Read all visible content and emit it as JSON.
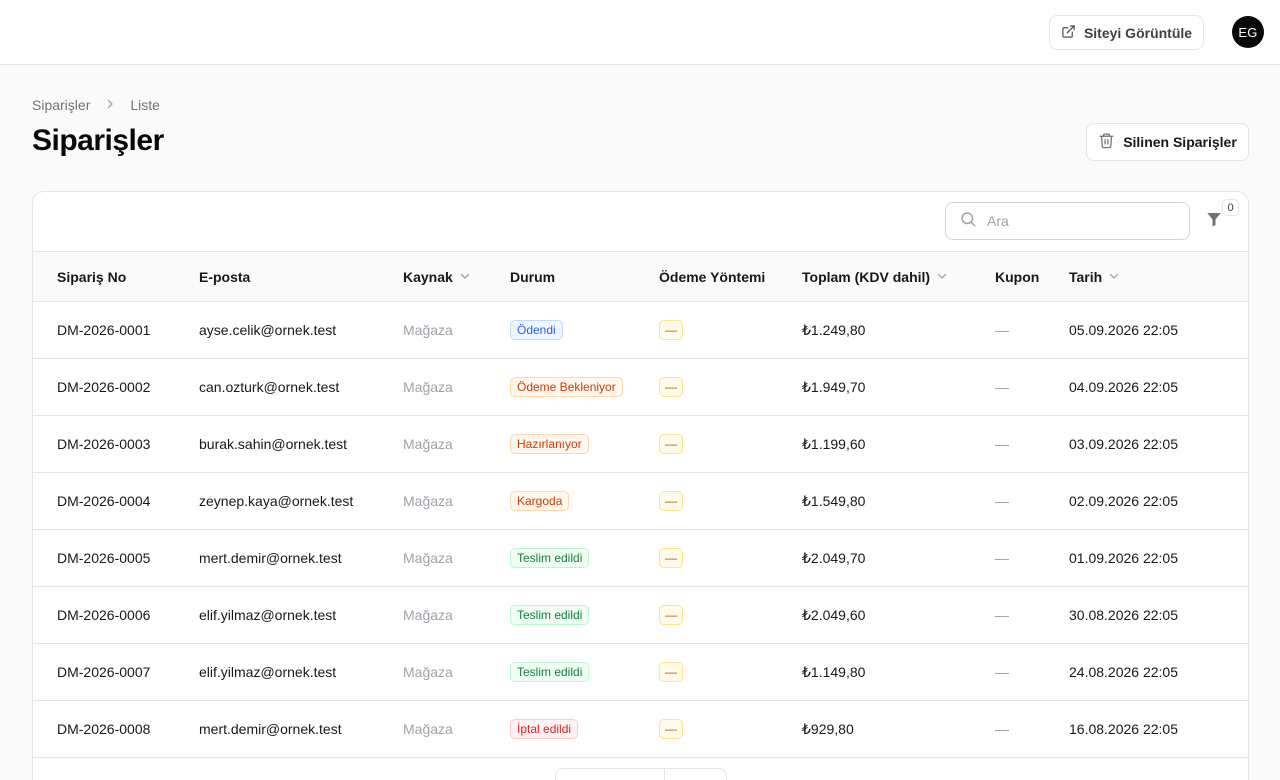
{
  "topbar": {
    "view_site_label": "Siteyi Görüntüle",
    "avatar_initials": "EG"
  },
  "breadcrumb": {
    "items": [
      "Siparişler",
      "Liste"
    ]
  },
  "page": {
    "title": "Siparişler",
    "deleted_orders_label": "Silinen Siparişler"
  },
  "table": {
    "search_placeholder": "Ara",
    "filter_count": "0",
    "columns": [
      "Sipariş No",
      "E-posta",
      "Kaynak",
      "Durum",
      "Ödeme Yöntemi",
      "Toplam (KDV dahil)",
      "Kupon",
      "Tarih"
    ],
    "rows": [
      {
        "no": "DM-2026-0001",
        "email": "ayse.celik@ornek.test",
        "source": "Mağaza",
        "status": "Ödendi",
        "status_color": "blue",
        "payment": "—",
        "total": "₺1.249,80",
        "coupon": "—",
        "date": "05.09.2026 22:05"
      },
      {
        "no": "DM-2026-0002",
        "email": "can.ozturk@ornek.test",
        "source": "Mağaza",
        "status": "Ödeme Bekleniyor",
        "status_color": "orange",
        "payment": "—",
        "total": "₺1.949,70",
        "coupon": "—",
        "date": "04.09.2026 22:05"
      },
      {
        "no": "DM-2026-0003",
        "email": "burak.sahin@ornek.test",
        "source": "Mağaza",
        "status": "Hazırlanıyor",
        "status_color": "orange",
        "payment": "—",
        "total": "₺1.199,60",
        "coupon": "—",
        "date": "03.09.2026 22:05"
      },
      {
        "no": "DM-2026-0004",
        "email": "zeynep.kaya@ornek.test",
        "source": "Mağaza",
        "status": "Kargoda",
        "status_color": "orange",
        "payment": "—",
        "total": "₺1.549,80",
        "coupon": "—",
        "date": "02.09.2026 22:05"
      },
      {
        "no": "DM-2026-0005",
        "email": "mert.demir@ornek.test",
        "source": "Mağaza",
        "status": "Teslim edildi",
        "status_color": "green",
        "payment": "—",
        "total": "₺2.049,70",
        "coupon": "—",
        "date": "01.09.2026 22:05"
      },
      {
        "no": "DM-2026-0006",
        "email": "elif.yilmaz@ornek.test",
        "source": "Mağaza",
        "status": "Teslim edildi",
        "status_color": "green",
        "payment": "—",
        "total": "₺2.049,60",
        "coupon": "—",
        "date": "30.08.2026 22:05"
      },
      {
        "no": "DM-2026-0007",
        "email": "elif.yilmaz@ornek.test",
        "source": "Mağaza",
        "status": "Teslim edildi",
        "status_color": "green",
        "payment": "—",
        "total": "₺1.149,80",
        "coupon": "—",
        "date": "24.08.2026 22:05"
      },
      {
        "no": "DM-2026-0008",
        "email": "mert.demir@ornek.test",
        "source": "Mağaza",
        "status": "İptal edildi",
        "status_color": "red",
        "payment": "—",
        "total": "₺929,80",
        "coupon": "—",
        "date": "16.08.2026 22:05"
      }
    ]
  },
  "icons": {
    "external_link": "external-link-icon",
    "chevron_right": "chevron-right-icon",
    "trash": "trash-icon",
    "search": "search-icon",
    "filter": "filter-icon",
    "sort": "chevron-down-icon"
  }
}
